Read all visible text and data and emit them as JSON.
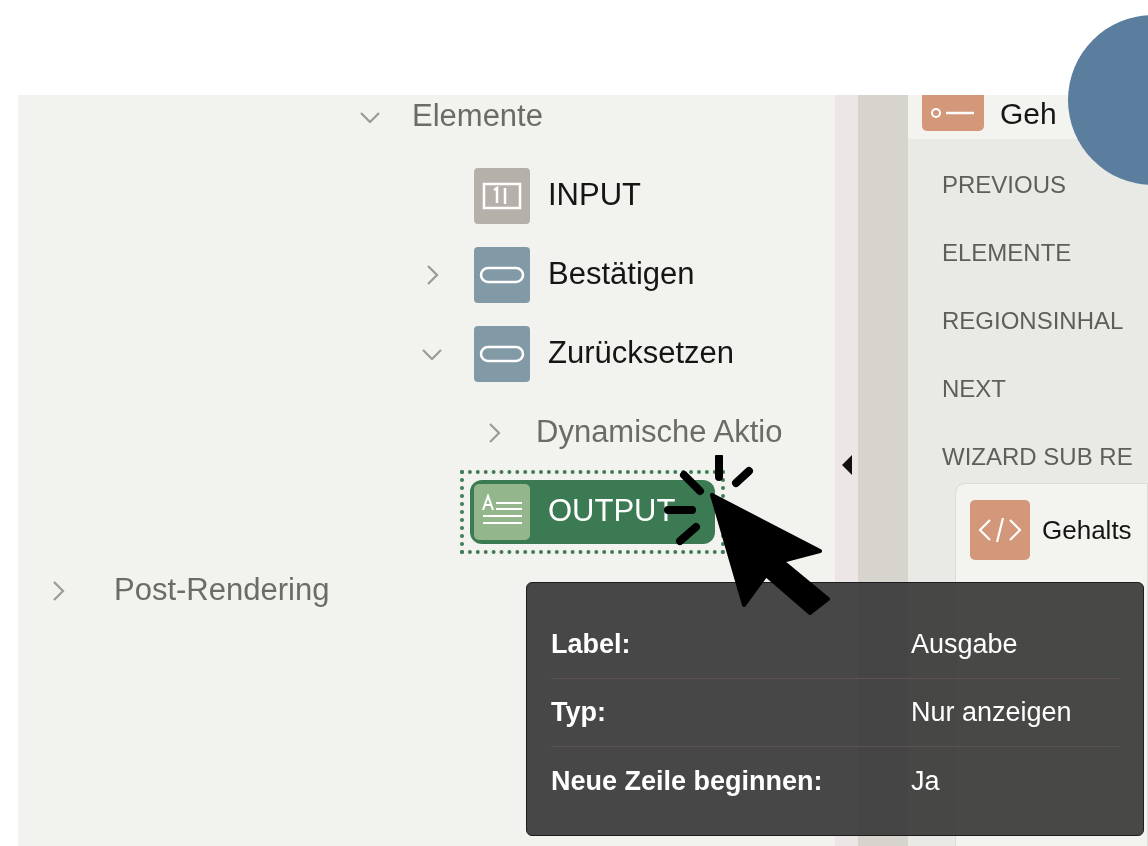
{
  "outline": [
    {
      "label": "Elemente",
      "kind": "folder",
      "expanded": true,
      "selected": false,
      "children": [
        {
          "label": "INPUT",
          "kind": "input",
          "selected": false
        },
        {
          "label": "Bestätigen",
          "kind": "button",
          "expanded": false,
          "selected": false
        },
        {
          "label": "Zurücksetzen",
          "kind": "button",
          "expanded": true,
          "selected": false,
          "children": [
            {
              "label": "Dynamische Aktio",
              "kind": "action",
              "expanded": false,
              "selected": false
            }
          ]
        },
        {
          "label": "OUTPUT",
          "kind": "output",
          "selected": true
        }
      ]
    }
  ],
  "post_rendering": {
    "label": "Post-Rendering",
    "expanded": false
  },
  "layout": {
    "header_title": "Geh",
    "sections": [
      "PREVIOUS",
      "ELEMENTE",
      "REGIONSINHAL",
      "NEXT",
      "WIZARD SUB RE"
    ],
    "sub_region": {
      "title": "Gehalts"
    }
  },
  "tooltip": {
    "rows": [
      {
        "label": "Label:",
        "value": "Ausgabe"
      },
      {
        "label": "Typ:",
        "value": "Nur anzeigen"
      },
      {
        "label": "Neue Zeile beginnen:",
        "value": "Ja"
      }
    ]
  }
}
